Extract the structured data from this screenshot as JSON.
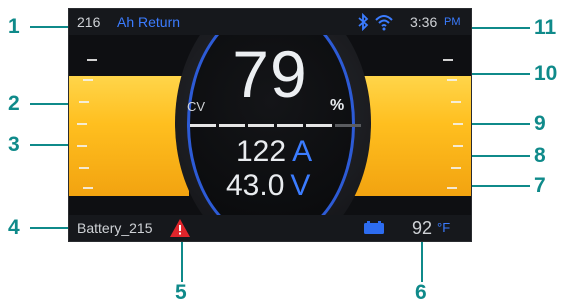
{
  "header": {
    "capacity_value": "216",
    "capacity_label": "Ah Return",
    "clock": "3:36",
    "ampm": "PM"
  },
  "gauge": {
    "charge_stage": "CV",
    "state_of_charge": "79",
    "soc_unit": "%",
    "current_value": "122",
    "current_unit": "A",
    "voltage_value": "43.0",
    "voltage_unit": "V",
    "charge_segments_filled": 5,
    "charge_segments_total": 6
  },
  "footer": {
    "battery_name": "Battery_215",
    "temperature_value": "92",
    "temperature_unit": "°F"
  },
  "icons": {
    "bluetooth": "bluetooth-icon",
    "wifi": "wifi-icon",
    "warning": "warning-icon",
    "battery": "battery-icon"
  },
  "colors": {
    "accent_blue": "#3b7cff",
    "amber": "#ffbf1f",
    "callout_teal": "#0f8a8a",
    "warning_red": "#e0252b"
  },
  "callouts": [
    "1",
    "2",
    "3",
    "4",
    "5",
    "6",
    "7",
    "8",
    "9",
    "10",
    "11"
  ]
}
